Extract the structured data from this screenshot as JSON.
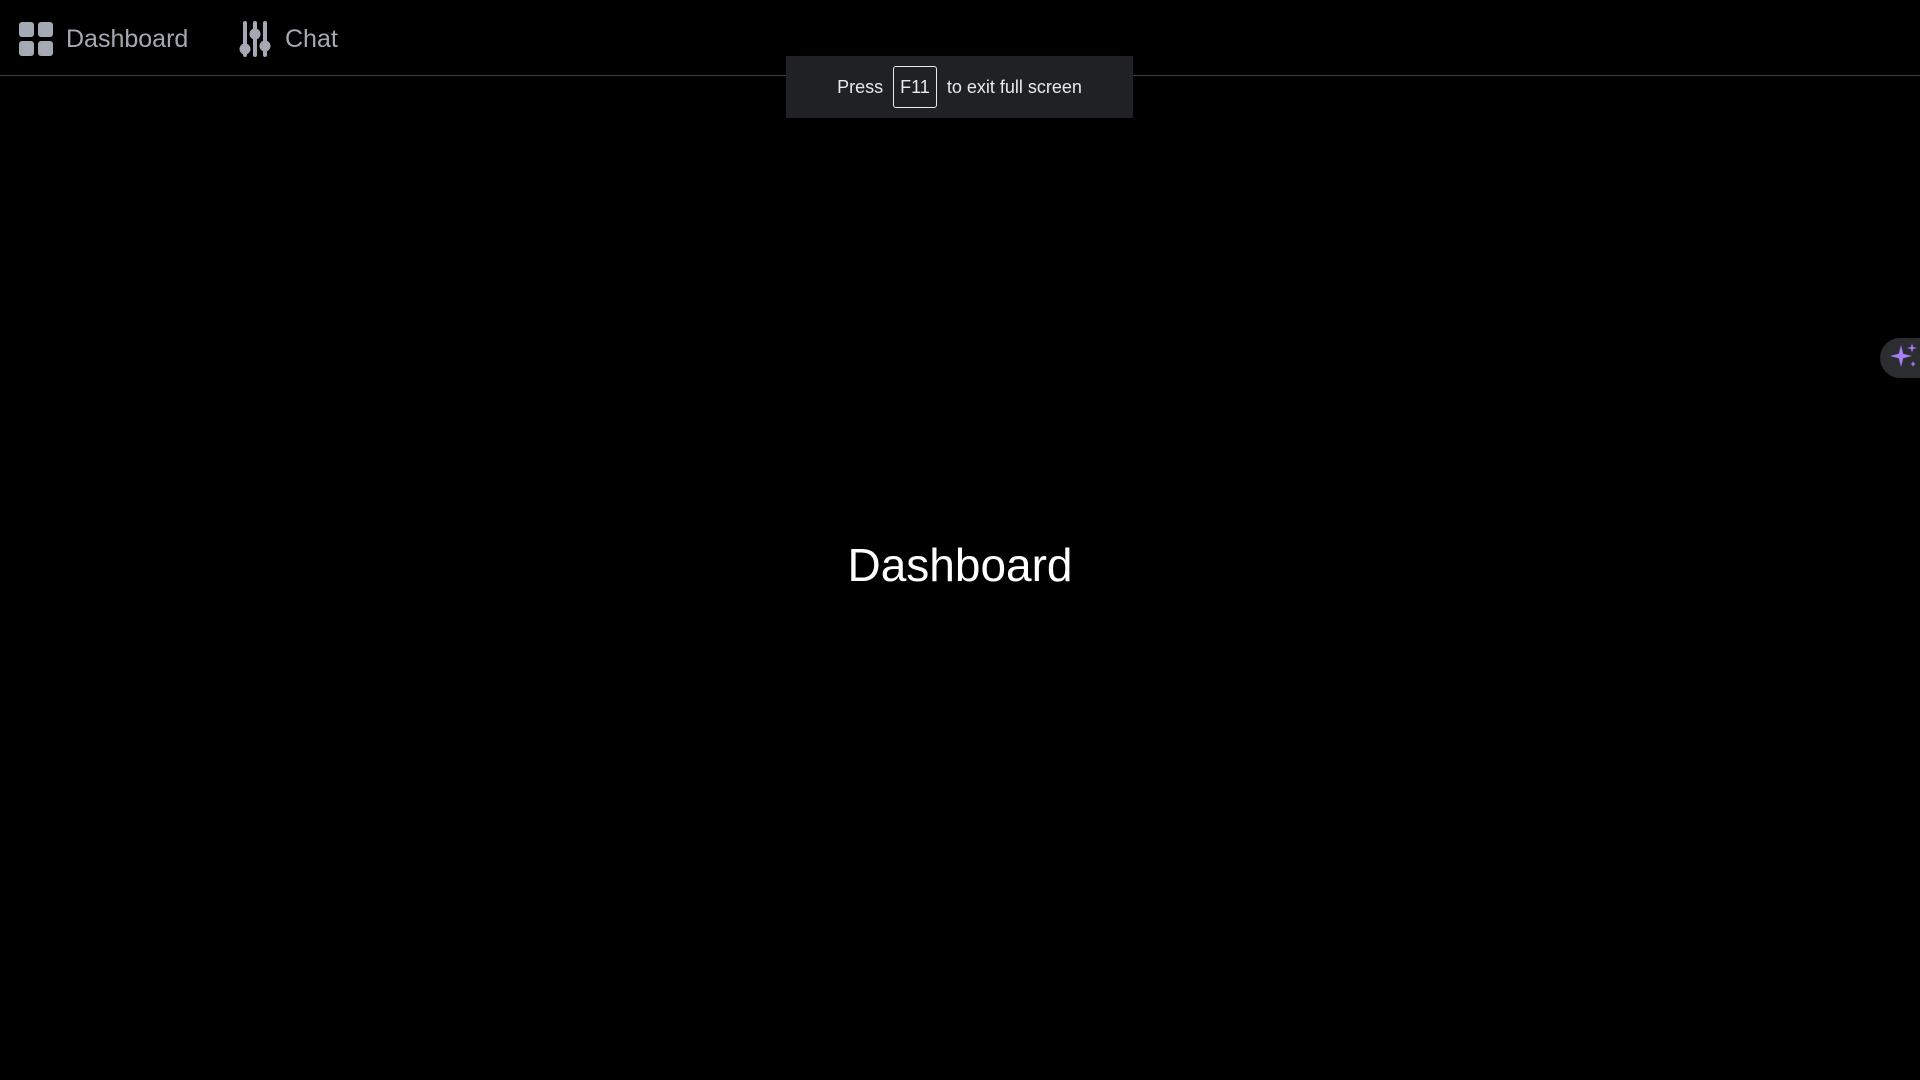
{
  "nav": {
    "items": [
      {
        "label": "Dashboard",
        "icon": "grid-icon"
      },
      {
        "label": "Chat",
        "icon": "sliders-icon"
      }
    ]
  },
  "fullscreen_toast": {
    "before": "Press",
    "key": "F11",
    "after": "to exit full screen"
  },
  "main": {
    "heading": "Dashboard"
  },
  "assistant": {
    "icon": "sparkle-icon",
    "color": "#a97df5"
  },
  "colors": {
    "background": "#000000",
    "nav_text": "#a3aab3",
    "heading": "#ffffff",
    "toast_bg": "#202124"
  }
}
